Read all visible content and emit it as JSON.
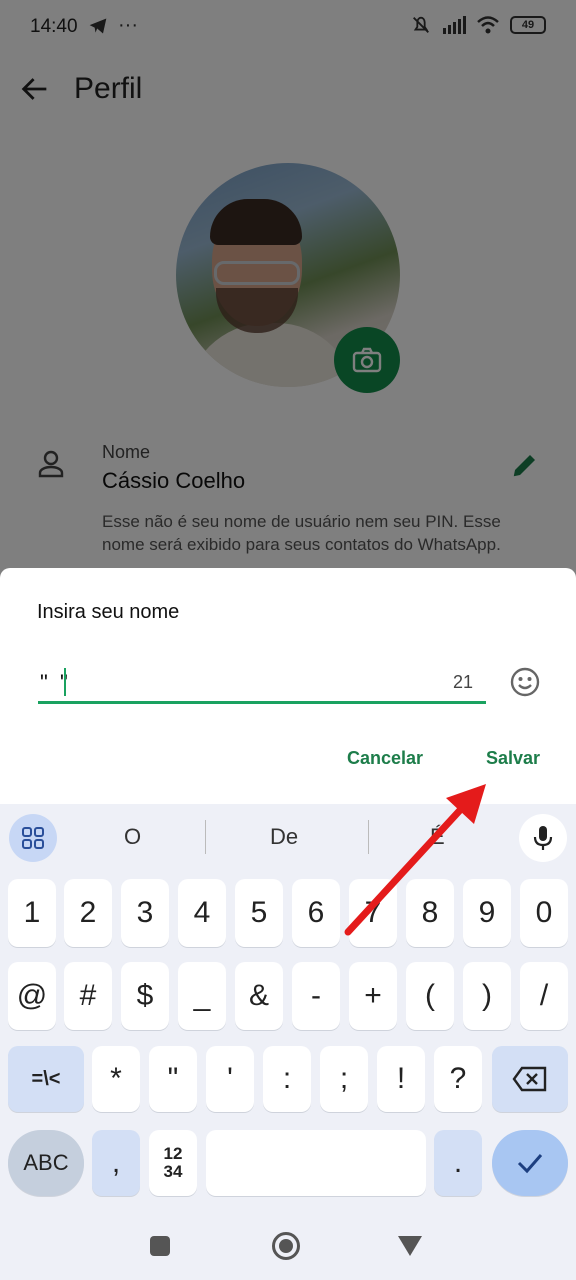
{
  "status_bar": {
    "time": "14:40",
    "battery": "49"
  },
  "app_bar": {
    "title": "Perfil"
  },
  "profile": {
    "name_label": "Nome",
    "name_value": "Cássio Coelho",
    "name_description": "Esse não é seu nome de usuário nem seu PIN. Esse nome será exibido para seus contatos do WhatsApp."
  },
  "dialog": {
    "title": "Insira seu nome",
    "input_value": "\"  \"",
    "char_counter": "21",
    "cancel_label": "Cancelar",
    "save_label": "Salvar"
  },
  "keyboard": {
    "suggestions": [
      "O",
      "De",
      "É"
    ],
    "row1": [
      "1",
      "2",
      "3",
      "4",
      "5",
      "6",
      "7",
      "8",
      "9",
      "0"
    ],
    "row2": [
      "@",
      "#",
      "$",
      "_",
      "&",
      "-",
      "+",
      "(",
      ")",
      "/"
    ],
    "row3": [
      "=\\<",
      "*",
      "\"",
      "'",
      ":",
      ";",
      "!",
      "?"
    ],
    "abc_label": "ABC",
    "comma_label": ",",
    "numpad_label_top": "12",
    "numpad_label_bottom": "34",
    "period_label": "."
  },
  "colors": {
    "accent": "#1aa260",
    "button_text": "#1d7d4a",
    "annotation_arrow": "#e41b1b"
  }
}
